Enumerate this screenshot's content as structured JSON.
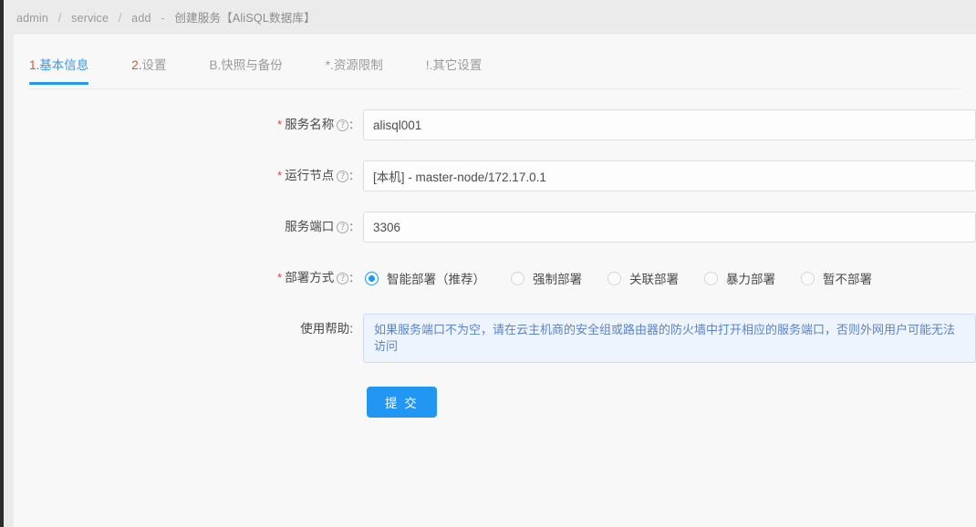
{
  "breadcrumb": {
    "items": [
      "admin",
      "service",
      "add"
    ],
    "separator": "/",
    "dash": "-",
    "current": "创建服务【AliSQL数据库】"
  },
  "tabs": [
    {
      "prefix": "1.",
      "label": "基本信息",
      "active": true
    },
    {
      "prefix": "2.",
      "label": "设置",
      "active": false
    },
    {
      "prefix": "B.",
      "label": "快照与备份",
      "active": false
    },
    {
      "prefix": "*.",
      "label": "资源限制",
      "active": false
    },
    {
      "prefix": "!.",
      "label": "其它设置",
      "active": false
    }
  ],
  "form": {
    "service_name": {
      "required": "*",
      "label": "服务名称",
      "help_icon": "?",
      "colon": ":",
      "value": "alisql001",
      "placeholder": ""
    },
    "run_node": {
      "required": "*",
      "label": "运行节点",
      "help_icon": "?",
      "colon": ":",
      "value": "[本机] - master-node/172.17.0.1",
      "placeholder": ""
    },
    "service_port": {
      "required": "",
      "label": "服务端口",
      "help_icon": "?",
      "colon": ":",
      "value": "3306",
      "placeholder": ""
    },
    "deploy_mode": {
      "required": "*",
      "label": "部署方式",
      "help_icon": "?",
      "colon": ":",
      "options": [
        {
          "label": "智能部署（推荐）",
          "selected": true
        },
        {
          "label": "强制部署",
          "selected": false
        },
        {
          "label": "关联部署",
          "selected": false
        },
        {
          "label": "暴力部署",
          "selected": false
        },
        {
          "label": "暂不部署",
          "selected": false
        }
      ]
    },
    "usage_help": {
      "required": "",
      "label": "使用帮助",
      "colon": ":",
      "text": "如果服务端口不为空，请在云主机商的安全组或路由器的防火墙中打开相应的服务端口，否则外网用户可能无法访问"
    },
    "submit_label": "提 交"
  },
  "colors": {
    "accent_blue": "#2196f3",
    "tab_active_text": "#3399ee",
    "tab_prefix_red": "#e2502a",
    "required_red": "#e4393c",
    "help_bg": "#eef4fd",
    "help_text": "#5b83c9",
    "page_bg": "#ebebeb",
    "card_bg": "#f8f8f8"
  }
}
